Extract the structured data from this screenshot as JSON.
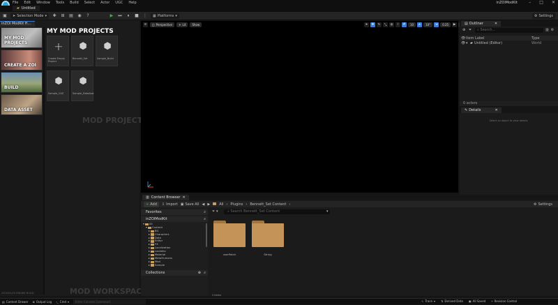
{
  "menubar": {
    "items": [
      "File",
      "Edit",
      "Window",
      "Tools",
      "Build",
      "Select",
      "Actor",
      "UGC",
      "Help"
    ],
    "app_title": "inZOIModKit"
  },
  "tab": {
    "label": "Untitled"
  },
  "toolbar": {
    "mode_label": "Selection Mode",
    "platforms_label": "Platforms",
    "settings_label": "Settings"
  },
  "left_panel": {
    "tab_label": "inZOI ModKit H...",
    "nav": [
      {
        "label": "MY MOD PROJECTS"
      },
      {
        "label": "CREATE A ZOI"
      },
      {
        "label": "BUILD"
      },
      {
        "label": "DATA ASSET"
      }
    ],
    "projects_title": "MY MOD PROJECTS",
    "projects": [
      {
        "label": "Create Empty Project",
        "icon": "plus-icon"
      },
      {
        "label": "Bennett_Set",
        "icon": "cube-icon"
      },
      {
        "label": "Sample_Build",
        "icon": "cube-icon"
      },
      {
        "label": "Sample_CAZ",
        "icon": "cube-icon"
      },
      {
        "label": "Sample_DataAsst",
        "icon": "cube-icon"
      }
    ],
    "watermark_projects": "MOD PROJECTS",
    "watermark_workspaces": "MOD WORKSPACES",
    "version": "2025/01/15 ENGINE BUILD"
  },
  "viewport": {
    "perspective": "Perspective",
    "lit": "Lit",
    "show": "Show",
    "grid_value": "10",
    "angle_value": "10°",
    "scale_value": "0.25",
    "camera_value": "1"
  },
  "outliner": {
    "tab_label": "Outliner",
    "search_placeholder": "Search...",
    "col_label": "Item Label",
    "col_type": "Type",
    "row_label": "Untitled (Editor)",
    "row_type": "World",
    "actor_count": "0 actors"
  },
  "details": {
    "tab_label": "Details",
    "empty_text": "Select an object to view details."
  },
  "content_browser": {
    "tab_label": "Content Browser",
    "add_label": "Add",
    "import_label": "Import",
    "saveall_label": "Save All",
    "breadcrumb": [
      "All",
      "Plugins",
      "Bennett_Set Content"
    ],
    "settings_label": "Settings",
    "favorites_label": "Favorites",
    "root_label": "inZOIModKit",
    "collections_label": "Collections",
    "search_placeholder": "Search Bennett_Set Content",
    "tree": [
      "All",
      "Content",
      "BG",
      "Characters",
      "Data",
      "Editor",
      "FX",
      "Localization",
      "Lookdev",
      "Material",
      "MetaHumans",
      "Mod",
      "Sample"
    ],
    "folders": [
      {
        "label": "userPatch"
      },
      {
        "label": "String"
      }
    ],
    "item_count": "2 items"
  },
  "statusbar": {
    "content_drawer": "Content Drawer",
    "output_log": "Output Log",
    "cmd": "Cmd",
    "console_placeholder": "Enter Console Command",
    "trace": "Trace",
    "derived_data": "Derived Data",
    "all_saved": "All Saved",
    "revision_control": "Revision Control"
  },
  "colors": {
    "accent": "#3a7bd5",
    "folder": "#c49357",
    "play": "#4caf50"
  }
}
